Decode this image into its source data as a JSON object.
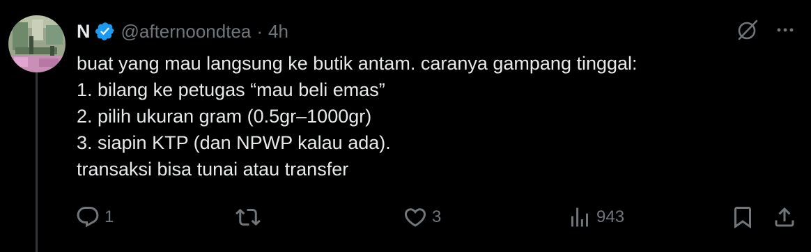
{
  "tweet": {
    "author": {
      "display_name": "N",
      "handle": "@afternoondtea",
      "verified": true
    },
    "separator": "·",
    "time": "4h",
    "text_lines": [
      "buat yang mau langsung ke butik antam. caranya gampang tinggal:",
      "1. bilang ke petugas “mau beli emas”",
      "2. pilih ukuran gram (0.5gr–1000gr)",
      "3. siapin KTP (dan NPWP kalau ada).",
      "transaksi bisa tunai atau transfer"
    ],
    "actions": {
      "reply_count": "1",
      "retweet_count": "",
      "like_count": "3",
      "views_count": "943"
    }
  },
  "icons": {
    "verified": "verified-badge-icon",
    "grok": "grok-icon",
    "more": "more-icon",
    "reply": "reply-icon",
    "retweet": "retweet-icon",
    "like": "heart-icon",
    "views": "views-icon",
    "bookmark": "bookmark-icon",
    "share": "share-icon"
  },
  "colors": {
    "background": "#000000",
    "text_primary": "#e7e9ea",
    "text_secondary": "#71767b",
    "verified_blue": "#1d9bf0",
    "thread_line": "#333639"
  }
}
